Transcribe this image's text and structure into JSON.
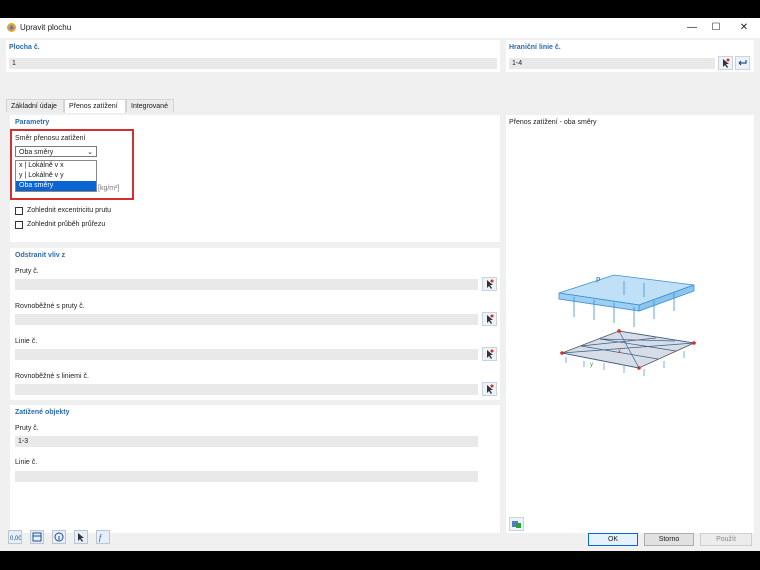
{
  "window": {
    "title": "Upravit plochu",
    "minimize": "—",
    "maximize": "☐",
    "close": "✕"
  },
  "header": {
    "surface_label": "Plocha č.",
    "surface_value": "1",
    "boundary_label": "Hraniční linie č.",
    "boundary_value": "1-4"
  },
  "tabs": [
    {
      "label": "Základní údaje"
    },
    {
      "label": "Přenos zatížení"
    },
    {
      "label": "Integrované"
    }
  ],
  "parameters": {
    "title": "Parametry",
    "direction_label": "Směr přenosu zatížení",
    "direction_value": "Oba směry",
    "options": [
      "x | Lokálně v x",
      "y | Lokálně v y",
      "Oba směry"
    ],
    "unit": "[kg/m²]",
    "eccentricity_label": "Zohlednit excentricitu prutu",
    "cross_section_label": "Zohlednit průběh průřezu"
  },
  "remove_influence": {
    "title": "Odstranit vliv z",
    "members_label": "Pruty č.",
    "parallel_members_label": "Rovnoběžné s pruty č.",
    "lines_label": "Linie č.",
    "parallel_lines_label": "Rovnoběžné s liniemi č."
  },
  "loaded_objects": {
    "title": "Zatížené objekty",
    "members_label": "Pruty č.",
    "members_value": "1-3",
    "lines_label": "Linie č."
  },
  "preview": {
    "title": "Přenos zatížení - oba směry",
    "load_symbol": "p",
    "axis_x": "x",
    "axis_y": "y"
  },
  "buttons": {
    "ok": "OK",
    "cancel": "Storno",
    "apply": "Použít"
  },
  "colors": {
    "accent": "#2e6aa8",
    "highlight": "#d32f2f",
    "selection": "#0a64d2",
    "load": "#3a8fd6"
  }
}
